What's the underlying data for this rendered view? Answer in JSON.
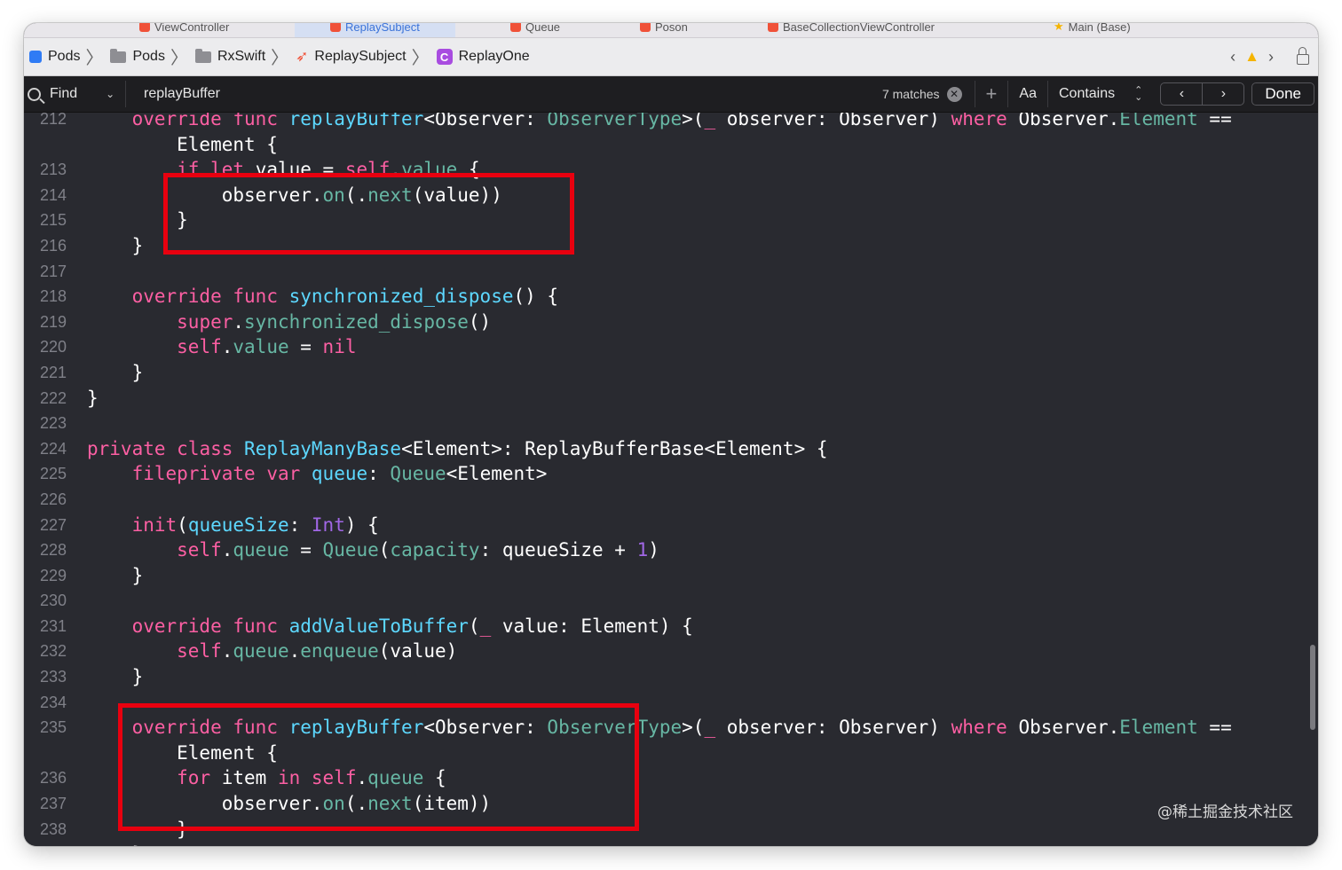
{
  "tabbar": {
    "tabs": [
      {
        "label": "ViewController"
      },
      {
        "label": "ReplaySubject",
        "active": true
      },
      {
        "label": "Queue"
      },
      {
        "label": "Poson"
      },
      {
        "label": "BaseCollectionViewController"
      },
      {
        "label": "Main (Base)"
      }
    ]
  },
  "jumpbar": {
    "crumbs": [
      {
        "label": "Pods",
        "icon": "project-icon"
      },
      {
        "label": "Pods",
        "icon": "folder-icon"
      },
      {
        "label": "RxSwift",
        "icon": "folder-icon"
      },
      {
        "label": "ReplaySubject",
        "icon": "swift-file-icon"
      },
      {
        "label": "ReplayOne",
        "icon": "class-icon"
      }
    ],
    "class_badge": "C",
    "warning_color": "#f5b400"
  },
  "findbar": {
    "mode": "Find",
    "query": "replayBuffer",
    "matches": "7 matches",
    "case_label": "Aa",
    "match_type": "Contains",
    "done_label": "Done"
  },
  "editor": {
    "keyword_color": "#fc5fa3",
    "type_color": "#5dd8ff",
    "function_color": "#67b7a4",
    "highlight_color": "#e8000f",
    "lines": [
      {
        "n": "212",
        "t": [
          [
            "    ",
            ""
          ],
          [
            "override",
            "kw"
          ],
          [
            " ",
            ""
          ],
          [
            "func",
            "kw"
          ],
          [
            " ",
            ""
          ],
          [
            "replayBuffer",
            "ty"
          ],
          [
            "<Observer: ",
            ""
          ],
          [
            "ObserverType",
            "fn"
          ],
          [
            ">(",
            ""
          ],
          [
            "_",
            "kw"
          ],
          [
            " observer: Observer) ",
            ""
          ],
          [
            "where",
            "kw"
          ],
          [
            " Observer.",
            ""
          ],
          [
            "Element",
            "fn"
          ],
          [
            " ==",
            ""
          ]
        ]
      },
      {
        "n": "",
        "t": [
          [
            "        Element {",
            ""
          ]
        ]
      },
      {
        "n": "213",
        "t": [
          [
            "        ",
            ""
          ],
          [
            "if",
            "kw"
          ],
          [
            " ",
            ""
          ],
          [
            "let",
            "kw"
          ],
          [
            " value = ",
            ""
          ],
          [
            "self",
            "kw"
          ],
          [
            ".",
            ""
          ],
          [
            "value",
            "fn"
          ],
          [
            " {",
            ""
          ]
        ]
      },
      {
        "n": "214",
        "t": [
          [
            "            observer.",
            ""
          ],
          [
            "on",
            "fn"
          ],
          [
            "(.",
            ""
          ],
          [
            "next",
            "fn"
          ],
          [
            "(value))",
            ""
          ]
        ]
      },
      {
        "n": "215",
        "t": [
          [
            "        }",
            ""
          ]
        ]
      },
      {
        "n": "216",
        "t": [
          [
            "    }",
            ""
          ]
        ]
      },
      {
        "n": "217",
        "t": [
          [
            "",
            ""
          ]
        ]
      },
      {
        "n": "218",
        "t": [
          [
            "    ",
            ""
          ],
          [
            "override",
            "kw"
          ],
          [
            " ",
            ""
          ],
          [
            "func",
            "kw"
          ],
          [
            " ",
            ""
          ],
          [
            "synchronized_dispose",
            "ty"
          ],
          [
            "() {",
            ""
          ]
        ]
      },
      {
        "n": "219",
        "t": [
          [
            "        ",
            ""
          ],
          [
            "super",
            "kw"
          ],
          [
            ".",
            ""
          ],
          [
            "synchronized_dispose",
            "fn"
          ],
          [
            "()",
            ""
          ]
        ]
      },
      {
        "n": "220",
        "t": [
          [
            "        ",
            ""
          ],
          [
            "self",
            "kw"
          ],
          [
            ".",
            ""
          ],
          [
            "value",
            "fn"
          ],
          [
            " = ",
            ""
          ],
          [
            "nil",
            "kw"
          ]
        ]
      },
      {
        "n": "221",
        "t": [
          [
            "    }",
            ""
          ]
        ]
      },
      {
        "n": "222",
        "t": [
          [
            "}",
            ""
          ]
        ]
      },
      {
        "n": "223",
        "t": [
          [
            "",
            ""
          ]
        ]
      },
      {
        "n": "224",
        "t": [
          [
            "private",
            "kw"
          ],
          [
            " ",
            ""
          ],
          [
            "class",
            "kw"
          ],
          [
            " ",
            ""
          ],
          [
            "ReplayManyBase",
            "ty"
          ],
          [
            "<Element>: ReplayBufferBase<Element> {",
            ""
          ]
        ]
      },
      {
        "n": "225",
        "t": [
          [
            "    ",
            ""
          ],
          [
            "fileprivate",
            "kw"
          ],
          [
            " ",
            ""
          ],
          [
            "var",
            "kw"
          ],
          [
            " ",
            ""
          ],
          [
            "queue",
            "ty"
          ],
          [
            ": ",
            ""
          ],
          [
            "Queue",
            "fn"
          ],
          [
            "<Element>",
            ""
          ]
        ]
      },
      {
        "n": "226",
        "t": [
          [
            "",
            ""
          ]
        ]
      },
      {
        "n": "227",
        "t": [
          [
            "    ",
            ""
          ],
          [
            "init",
            "kw"
          ],
          [
            "(",
            ""
          ],
          [
            "queueSize",
            "ty"
          ],
          [
            ": ",
            ""
          ],
          [
            "Int",
            "pr"
          ],
          [
            ") {",
            ""
          ]
        ]
      },
      {
        "n": "228",
        "t": [
          [
            "        ",
            ""
          ],
          [
            "self",
            "kw"
          ],
          [
            ".",
            ""
          ],
          [
            "queue",
            "fn"
          ],
          [
            " = ",
            ""
          ],
          [
            "Queue",
            "fn"
          ],
          [
            "(",
            ""
          ],
          [
            "capacity",
            "fn"
          ],
          [
            ": queueSize + ",
            ""
          ],
          [
            "1",
            "pr"
          ],
          [
            ")",
            ""
          ]
        ]
      },
      {
        "n": "229",
        "t": [
          [
            "    }",
            ""
          ]
        ]
      },
      {
        "n": "230",
        "t": [
          [
            "",
            ""
          ]
        ]
      },
      {
        "n": "231",
        "t": [
          [
            "    ",
            ""
          ],
          [
            "override",
            "kw"
          ],
          [
            " ",
            ""
          ],
          [
            "func",
            "kw"
          ],
          [
            " ",
            ""
          ],
          [
            "addValueToBuffer",
            "ty"
          ],
          [
            "(",
            ""
          ],
          [
            "_",
            "kw"
          ],
          [
            " value: Element) {",
            ""
          ]
        ]
      },
      {
        "n": "232",
        "t": [
          [
            "        ",
            ""
          ],
          [
            "self",
            "kw"
          ],
          [
            ".",
            ""
          ],
          [
            "queue",
            "fn"
          ],
          [
            ".",
            ""
          ],
          [
            "enqueue",
            "fn"
          ],
          [
            "(value)",
            ""
          ]
        ]
      },
      {
        "n": "233",
        "t": [
          [
            "    }",
            ""
          ]
        ]
      },
      {
        "n": "234",
        "t": [
          [
            "",
            ""
          ]
        ]
      },
      {
        "n": "235",
        "t": [
          [
            "    ",
            ""
          ],
          [
            "override",
            "kw"
          ],
          [
            " ",
            ""
          ],
          [
            "func",
            "kw"
          ],
          [
            " ",
            ""
          ],
          [
            "replayBuffer",
            "ty"
          ],
          [
            "<Observer: ",
            ""
          ],
          [
            "ObserverType",
            "fn"
          ],
          [
            ">(",
            ""
          ],
          [
            "_",
            "kw"
          ],
          [
            " observer: Observer) ",
            ""
          ],
          [
            "where",
            "kw"
          ],
          [
            " Observer.",
            ""
          ],
          [
            "Element",
            "fn"
          ],
          [
            " ==",
            ""
          ]
        ]
      },
      {
        "n": "",
        "t": [
          [
            "        Element {",
            ""
          ]
        ]
      },
      {
        "n": "236",
        "t": [
          [
            "        ",
            ""
          ],
          [
            "for",
            "kw"
          ],
          [
            " item ",
            ""
          ],
          [
            "in",
            "kw"
          ],
          [
            " ",
            ""
          ],
          [
            "self",
            "kw"
          ],
          [
            ".",
            ""
          ],
          [
            "queue",
            "fn"
          ],
          [
            " {",
            ""
          ]
        ]
      },
      {
        "n": "237",
        "t": [
          [
            "            observer.",
            ""
          ],
          [
            "on",
            "fn"
          ],
          [
            "(.",
            ""
          ],
          [
            "next",
            "fn"
          ],
          [
            "(item))",
            ""
          ]
        ]
      },
      {
        "n": "238",
        "t": [
          [
            "        }",
            ""
          ]
        ]
      },
      {
        "n": "",
        "t": [
          [
            "    }",
            ""
          ]
        ]
      }
    ]
  },
  "watermark": "@稀土掘金技术社区"
}
